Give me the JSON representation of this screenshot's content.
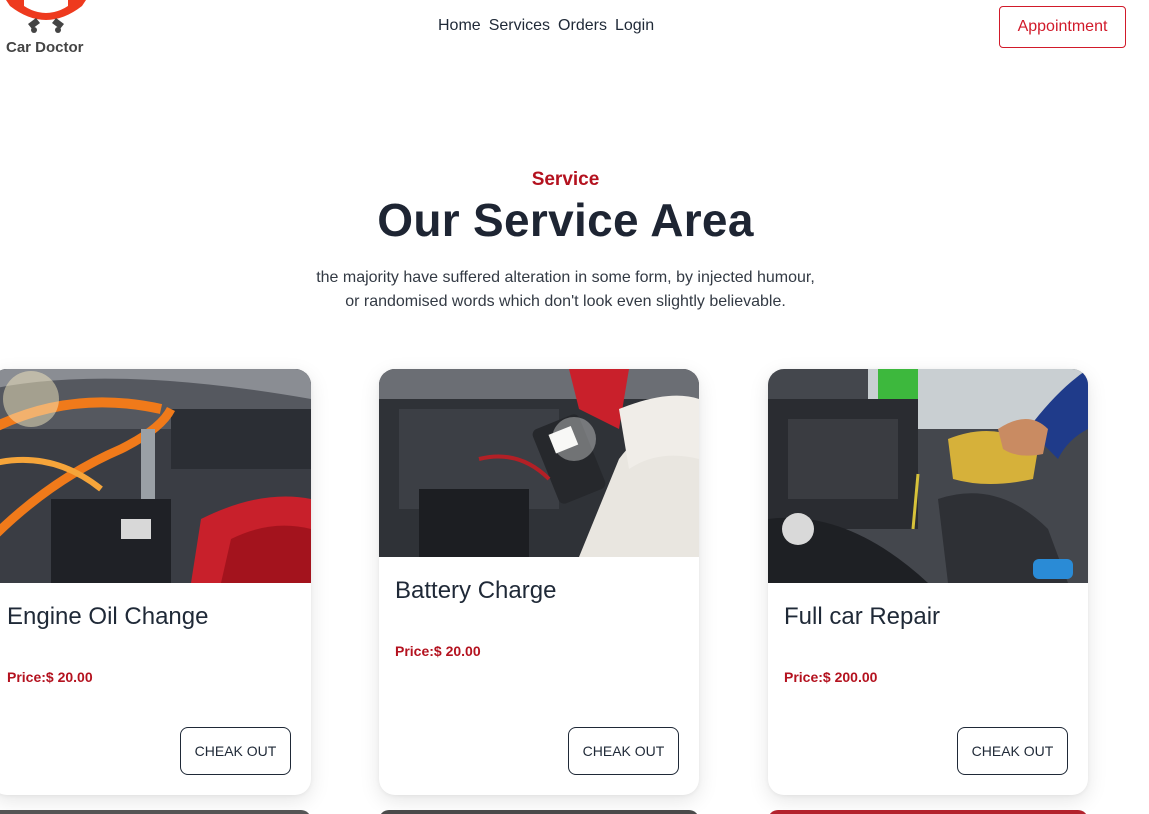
{
  "brand": {
    "name": "Car Doctor",
    "accent": "#d11a2a"
  },
  "nav": {
    "items": [
      "Home",
      "Services",
      "Orders",
      "Login"
    ]
  },
  "appointment_label": "Appointment",
  "section": {
    "eyebrow": "Service",
    "title": "Our Service Area",
    "description_line1": "the majority have suffered alteration in some form, by injected humour,",
    "description_line2": "or randomised words which don't look even slightly believable."
  },
  "services": [
    {
      "title": "Engine Oil Change",
      "price": "Price:$ 20.00",
      "button": "CHEAK OUT",
      "image_icon": "engine-battery-photo"
    },
    {
      "title": "Battery Charge",
      "price": "Price:$ 20.00",
      "button": "CHEAK OUT",
      "image_icon": "battery-tester-photo"
    },
    {
      "title": "Full car Repair",
      "price": "Price:$ 200.00",
      "button": "CHEAK OUT",
      "image_icon": "oil-pour-photo"
    }
  ]
}
